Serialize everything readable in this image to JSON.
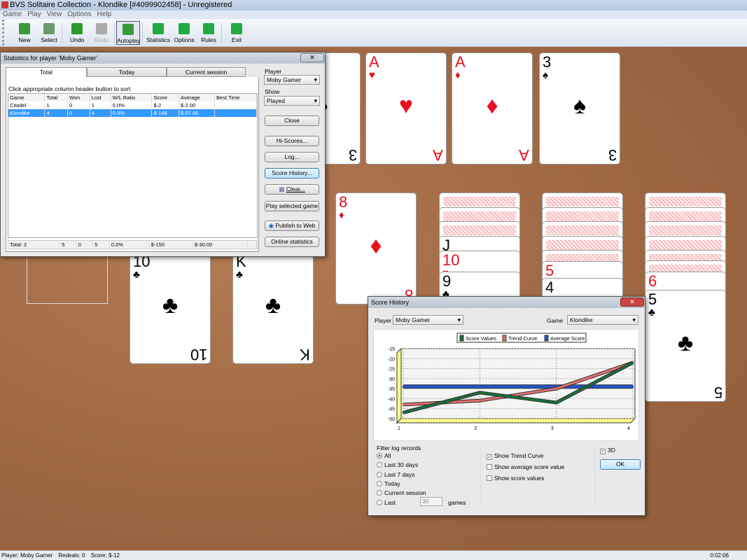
{
  "window": {
    "title": "BVS Solitaire Collection  -  Klondike [#4099902458] - Unregistered"
  },
  "menu": [
    "Game",
    "Play",
    "View",
    "Options",
    "Help"
  ],
  "toolbar": [
    {
      "label": "New",
      "icon": "new-game-icon",
      "color": "#3a9a3a",
      "enabled": true
    },
    {
      "label": "Select",
      "icon": "select-game-icon",
      "color": "#6a9a6a",
      "enabled": true
    },
    {
      "label": "Undo",
      "icon": "undo-icon",
      "color": "#2a9a2a",
      "enabled": true
    },
    {
      "label": "Redo",
      "icon": "redo-icon",
      "color": "#aaaaaa",
      "enabled": false
    },
    {
      "label": "Autoplay",
      "icon": "autoplay-icon",
      "color": "#3a9a3a",
      "enabled": true,
      "pressed": true
    },
    {
      "label": "Statistics",
      "icon": "statistics-icon",
      "color": "#22aa44",
      "enabled": true
    },
    {
      "label": "Options",
      "icon": "options-icon",
      "color": "#22aa44",
      "enabled": true
    },
    {
      "label": "Rules",
      "icon": "rules-icon",
      "color": "#22aa44",
      "enabled": true
    },
    {
      "label": "Exit",
      "icon": "exit-icon",
      "color": "#22aa44",
      "enabled": true
    }
  ],
  "cards": [
    {
      "pile": "stock-partial",
      "rank": "3",
      "suit": "♣",
      "color": "blk"
    },
    {
      "pile": "foundation-1",
      "rank": "A",
      "suit": "♥",
      "color": "red"
    },
    {
      "pile": "foundation-2",
      "rank": "A",
      "suit": "♦",
      "color": "red"
    },
    {
      "pile": "foundation-3",
      "rank": "3",
      "suit": "♠",
      "color": "blk"
    },
    {
      "pile": "tableau-1",
      "rank": "10",
      "suit": "♣",
      "color": "blk"
    },
    {
      "pile": "tableau-2",
      "rank": "K",
      "suit": "♣",
      "color": "blk"
    },
    {
      "pile": "tableau-3",
      "rank": "8",
      "suit": "♦",
      "color": "red"
    },
    {
      "pile": "tableau-4",
      "rank": "J",
      "suit": "♠",
      "color": "blk"
    },
    {
      "pile": "tableau-4",
      "rank": "10",
      "suit": "♥",
      "color": "red"
    },
    {
      "pile": "tableau-4",
      "rank": "9",
      "suit": "♣",
      "color": "blk"
    },
    {
      "pile": "tableau-5",
      "rank": "5",
      "suit": "♥",
      "color": "red"
    },
    {
      "pile": "tableau-5",
      "rank": "4",
      "suit": "♠",
      "color": "blk"
    },
    {
      "pile": "tableau-6",
      "rank": "6",
      "suit": "♥",
      "color": "red"
    },
    {
      "pile": "tableau-6",
      "rank": "5",
      "suit": "♣",
      "color": "blk"
    }
  ],
  "stats": {
    "title": "Statistics for player 'Moby Gamer'",
    "close_x": "✕",
    "tabs": [
      "Total",
      "Today",
      "Current session"
    ],
    "hint": "Click appropriate column header button to sort",
    "columns": [
      "Game",
      "Total",
      "Won",
      "Lost",
      "W/L Ratio",
      "Score",
      "Average",
      "Best Time"
    ],
    "rows": [
      [
        "Citadel",
        "1",
        "0",
        "1",
        "0.0%",
        "$-2",
        "$-2.00",
        ""
      ],
      [
        "Klondike",
        "4",
        "0",
        "4",
        "0.0%",
        "$-148",
        "$-37.00",
        ""
      ]
    ],
    "selected_row": 1,
    "totals": [
      "Total: 2",
      "5",
      "0",
      "5",
      "0.0%",
      "$-150",
      "$-30.00",
      ""
    ],
    "player_label": "Player",
    "player_value": "Moby Gamer",
    "show_label": "Show",
    "show_value": "Played",
    "buttons": {
      "close": "Close",
      "hiscores": "Hi-Scores...",
      "log": "Log...",
      "score_history": "Score History...",
      "clear": "Clear...",
      "play_selected": "Play selected game",
      "publish": "Publish to Web",
      "online": "Online statistics"
    }
  },
  "history": {
    "title": "Score History",
    "close_x": "✕",
    "player_label": "Player",
    "player_value": "Moby Gamer",
    "game_label": "Game",
    "game_value": "Klondike",
    "filter_label": "Filter log records",
    "filters": [
      {
        "label": "All",
        "on": true
      },
      {
        "label": "Last 30 days",
        "on": false
      },
      {
        "label": "Last 7 days",
        "on": false
      },
      {
        "label": "Today",
        "on": false
      },
      {
        "label": "Current session",
        "on": false
      },
      {
        "label": "Last",
        "on": false
      }
    ],
    "last_count": "30",
    "games_label": "games",
    "options": [
      {
        "label": "Show Trend Curve",
        "checked": true
      },
      {
        "label": "Show average score value",
        "checked": false
      },
      {
        "label": "Show score values",
        "checked": false
      }
    ],
    "three_d": {
      "label": "3D",
      "checked": true
    },
    "ok": "OK"
  },
  "chart_data": {
    "type": "line",
    "x": [
      1,
      2,
      3,
      4
    ],
    "ylim": [
      -50,
      -15
    ],
    "yticks": [
      -15,
      -20,
      -25,
      -30,
      -35,
      -40,
      -45,
      -50
    ],
    "grid": true,
    "three_d": true,
    "legend_placement": "top",
    "series": [
      {
        "name": "Score Values",
        "values": [
          -47,
          -37,
          -42,
          -22
        ],
        "color": "#1a6e3a"
      },
      {
        "name": "Trend Curve",
        "values": [
          -43,
          -41,
          -35,
          -22
        ],
        "color": "#e07070"
      },
      {
        "name": "Average Score",
        "values": [
          -34,
          -34,
          -34,
          -34
        ],
        "color": "#2255cc"
      }
    ]
  },
  "status": {
    "player": "Player: Moby Gamer",
    "redeals": "Redeals: 0",
    "score": "Score: $-12",
    "time": "0:02:06"
  }
}
